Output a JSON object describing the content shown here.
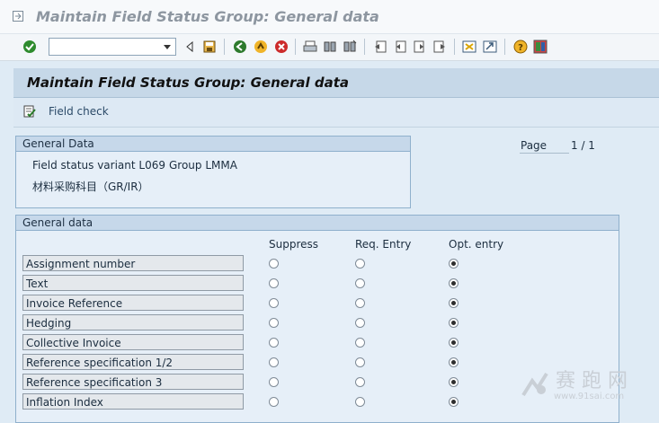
{
  "window": {
    "title": "Maintain Field Status Group: General data"
  },
  "header": {
    "title": "Maintain Field Status Group: General data"
  },
  "app_toolbar": {
    "field_check_label": "Field check"
  },
  "general_data_box": {
    "caption": "General Data",
    "variant_text": "Field status variant L069",
    "group_text": "Group LMMA",
    "description": "材料采购科目（GR/IR）"
  },
  "pager": {
    "label": "Page",
    "value": "1 / 1"
  },
  "fields_box": {
    "caption": "General data",
    "columns": [
      "Suppress",
      "Req. Entry",
      "Opt. entry"
    ],
    "rows": [
      {
        "label": "Assignment number",
        "selected": "opt"
      },
      {
        "label": "Text",
        "selected": "opt"
      },
      {
        "label": "Invoice Reference",
        "selected": "opt"
      },
      {
        "label": "Hedging",
        "selected": "opt"
      },
      {
        "label": "Collective Invoice",
        "selected": "opt"
      },
      {
        "label": "Reference specification 1/2",
        "selected": "opt"
      },
      {
        "label": "Reference specification 3",
        "selected": "opt"
      },
      {
        "label": "Inflation Index",
        "selected": "opt"
      }
    ]
  },
  "watermark": {
    "text": "赛 跑 网",
    "url": "www.91sai.com"
  },
  "colors": {
    "header_bg": "#c6d8e8",
    "body_bg": "#dfebf5",
    "box_border": "#8fb0cc"
  },
  "icons": [
    "exit-icon",
    "enter-icon",
    "dropdown-icon",
    "back-arrow-icon",
    "save-icon",
    "back-icon",
    "exit-nav-icon",
    "cancel-icon",
    "print-icon",
    "find-icon",
    "find-next-icon",
    "first-page-icon",
    "previous-page-icon",
    "next-page-icon",
    "last-page-icon",
    "create-session-icon",
    "shortcut-icon",
    "help-icon",
    "layout-icon",
    "field-check-icon"
  ]
}
